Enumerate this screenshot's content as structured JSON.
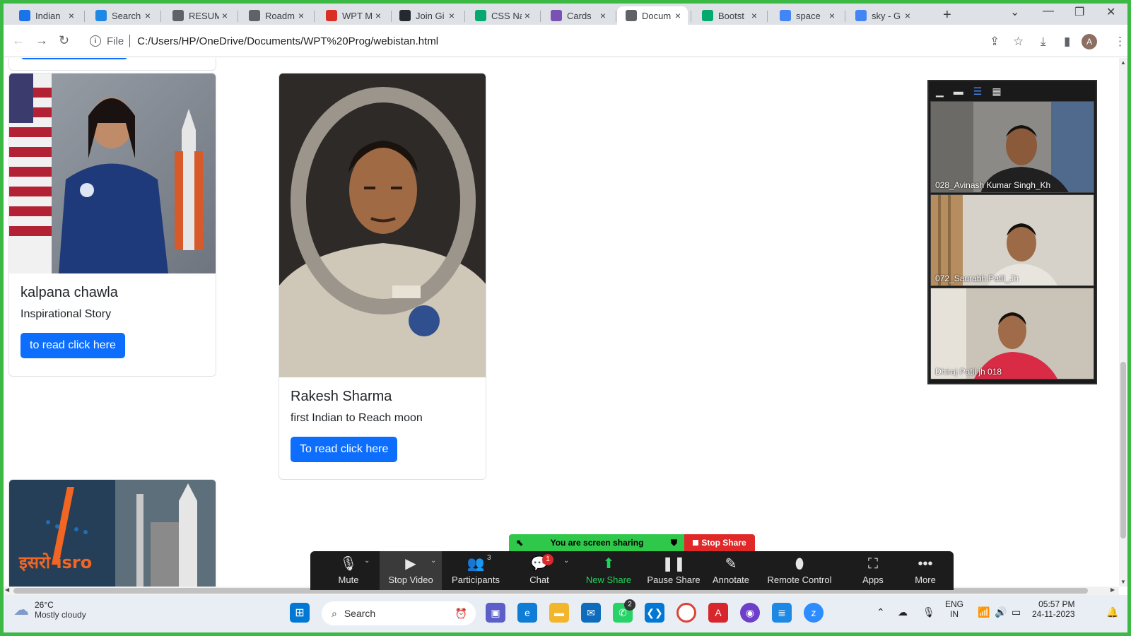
{
  "browser": {
    "tabs": [
      {
        "title": "Indian",
        "favicon": "doc-icon",
        "color": "#1a73e8"
      },
      {
        "title": "Search",
        "favicon": "m-icon",
        "color": "#1e88e5"
      },
      {
        "title": "RESUM",
        "favicon": "globe-icon",
        "color": "#5f6368"
      },
      {
        "title": "Roadm",
        "favicon": "bulb-icon",
        "color": "#5f6368"
      },
      {
        "title": "WPT M",
        "favicon": "gmail-icon",
        "color": "#d93025"
      },
      {
        "title": "Join Gi",
        "favicon": "github-icon",
        "color": "#24292f"
      },
      {
        "title": "CSS Na",
        "favicon": "w3-icon",
        "color": "#04aa6d"
      },
      {
        "title": "Cards",
        "favicon": "bootstrap-icon",
        "color": "#7952b3"
      },
      {
        "title": "Docum",
        "favicon": "globe-icon",
        "color": "#5f6368"
      },
      {
        "title": "Bootst",
        "favicon": "w3-icon",
        "color": "#04aa6d"
      },
      {
        "title": "space",
        "favicon": "google-icon",
        "color": "#4285f4"
      },
      {
        "title": "sky - G",
        "favicon": "google-icon",
        "color": "#4285f4"
      }
    ],
    "active_tab_index": 8,
    "address_prefix": "File",
    "url": "C:/Users/HP/OneDrive/Documents/WPT%20Prog/webistan.html",
    "profile_initial": "A"
  },
  "page": {
    "cards": [
      {
        "title": "kalpana chawla",
        "text": "Inspirational Story",
        "button": "to read click here"
      },
      {
        "title": "Rakesh Sharma",
        "text": "first Indian to Reach moon",
        "button": "To read click here"
      }
    ],
    "isro_logo_text": "इसरो isro"
  },
  "zoom": {
    "participants_video": [
      {
        "name": "028_Avinash Kumar Singh_Kh"
      },
      {
        "name": "072_Saurabh Patil_Jh"
      },
      {
        "name": "Dhiraj Patil jh 018"
      }
    ],
    "share_status": "You are screen sharing",
    "stop_share": "Stop Share",
    "toolbar": {
      "mute": "Mute",
      "stop_video": "Stop Video",
      "participants": "Participants",
      "participants_count": "3",
      "chat": "Chat",
      "chat_badge": "1",
      "new_share": "New Share",
      "pause_share": "Pause Share",
      "annotate": "Annotate",
      "remote_control": "Remote Control",
      "apps": "Apps",
      "more": "More"
    }
  },
  "taskbar": {
    "temperature": "26°C",
    "weather": "Mostly cloudy",
    "search": "Search",
    "whatsapp_badge": "2",
    "lang_line1": "ENG",
    "lang_line2": "IN",
    "time": "05:57 PM",
    "date": "24-11-2023"
  }
}
